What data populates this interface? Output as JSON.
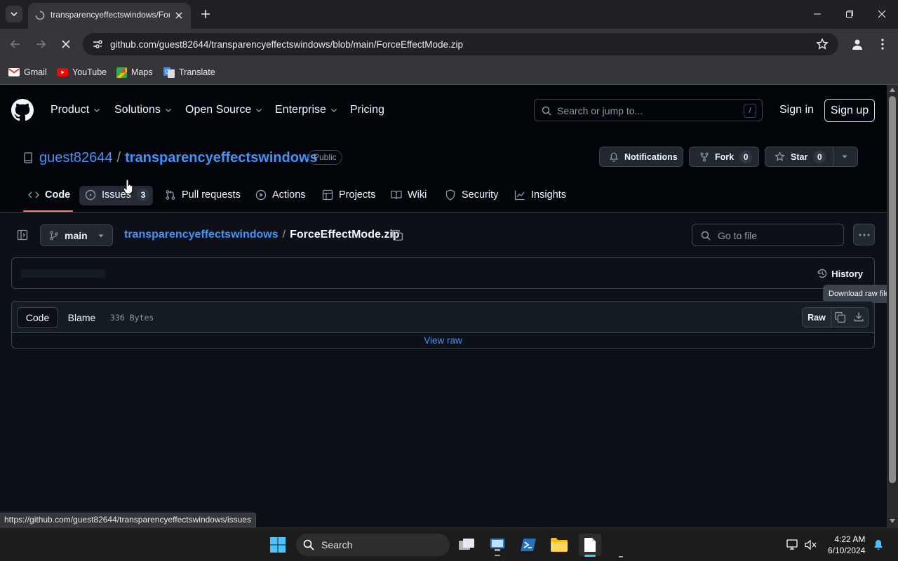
{
  "browser": {
    "tab_title": "transparencyeffectswindows/ForceEffectMode.zip",
    "url": "github.com/guest82644/transparencyeffectswindows/blob/main/ForceEffectMode.zip",
    "bookmarks": [
      "Gmail",
      "YouTube",
      "Maps",
      "Translate"
    ],
    "status_url": "https://github.com/guest82644/transparencyeffectswindows/issues"
  },
  "github": {
    "nav": [
      "Product",
      "Solutions",
      "Open Source",
      "Enterprise",
      "Pricing"
    ],
    "search_placeholder": "Search or jump to...",
    "search_key": "/",
    "sign_in": "Sign in",
    "sign_up": "Sign up"
  },
  "repo": {
    "owner": "guest82644",
    "separator": "/",
    "name": "transparencyeffectswindows",
    "visibility": "Public",
    "notifications_label": "Notifications",
    "fork_label": "Fork",
    "fork_count": "0",
    "star_label": "Star",
    "star_count": "0",
    "tabs": [
      {
        "label": "Code",
        "icon": "code-icon"
      },
      {
        "label": "Issues",
        "icon": "issue-icon",
        "count": "3"
      },
      {
        "label": "Pull requests",
        "icon": "pull-request-icon"
      },
      {
        "label": "Actions",
        "icon": "play-icon"
      },
      {
        "label": "Projects",
        "icon": "table-icon"
      },
      {
        "label": "Wiki",
        "icon": "book-icon"
      },
      {
        "label": "Security",
        "icon": "shield-icon"
      },
      {
        "label": "Insights",
        "icon": "graph-icon"
      }
    ]
  },
  "file": {
    "branch": "main",
    "repo_link": "transparencyeffectswindows",
    "separator": "/",
    "filename": "ForceEffectMode.zip",
    "goto_placeholder": "Go to file",
    "history_label": "History",
    "tooltip": "Download raw file",
    "code_tab": "Code",
    "blame_tab": "Blame",
    "size": "336 Bytes",
    "raw_label": "Raw",
    "view_raw": "View raw"
  },
  "taskbar": {
    "search_label": "Search",
    "time": "4:22 AM",
    "date": "6/10/2024"
  },
  "colors": {
    "accent_link": "#4493f8",
    "tab_underline": "#f78166",
    "page_bg": "#0d1117",
    "header_bg": "#010409"
  }
}
